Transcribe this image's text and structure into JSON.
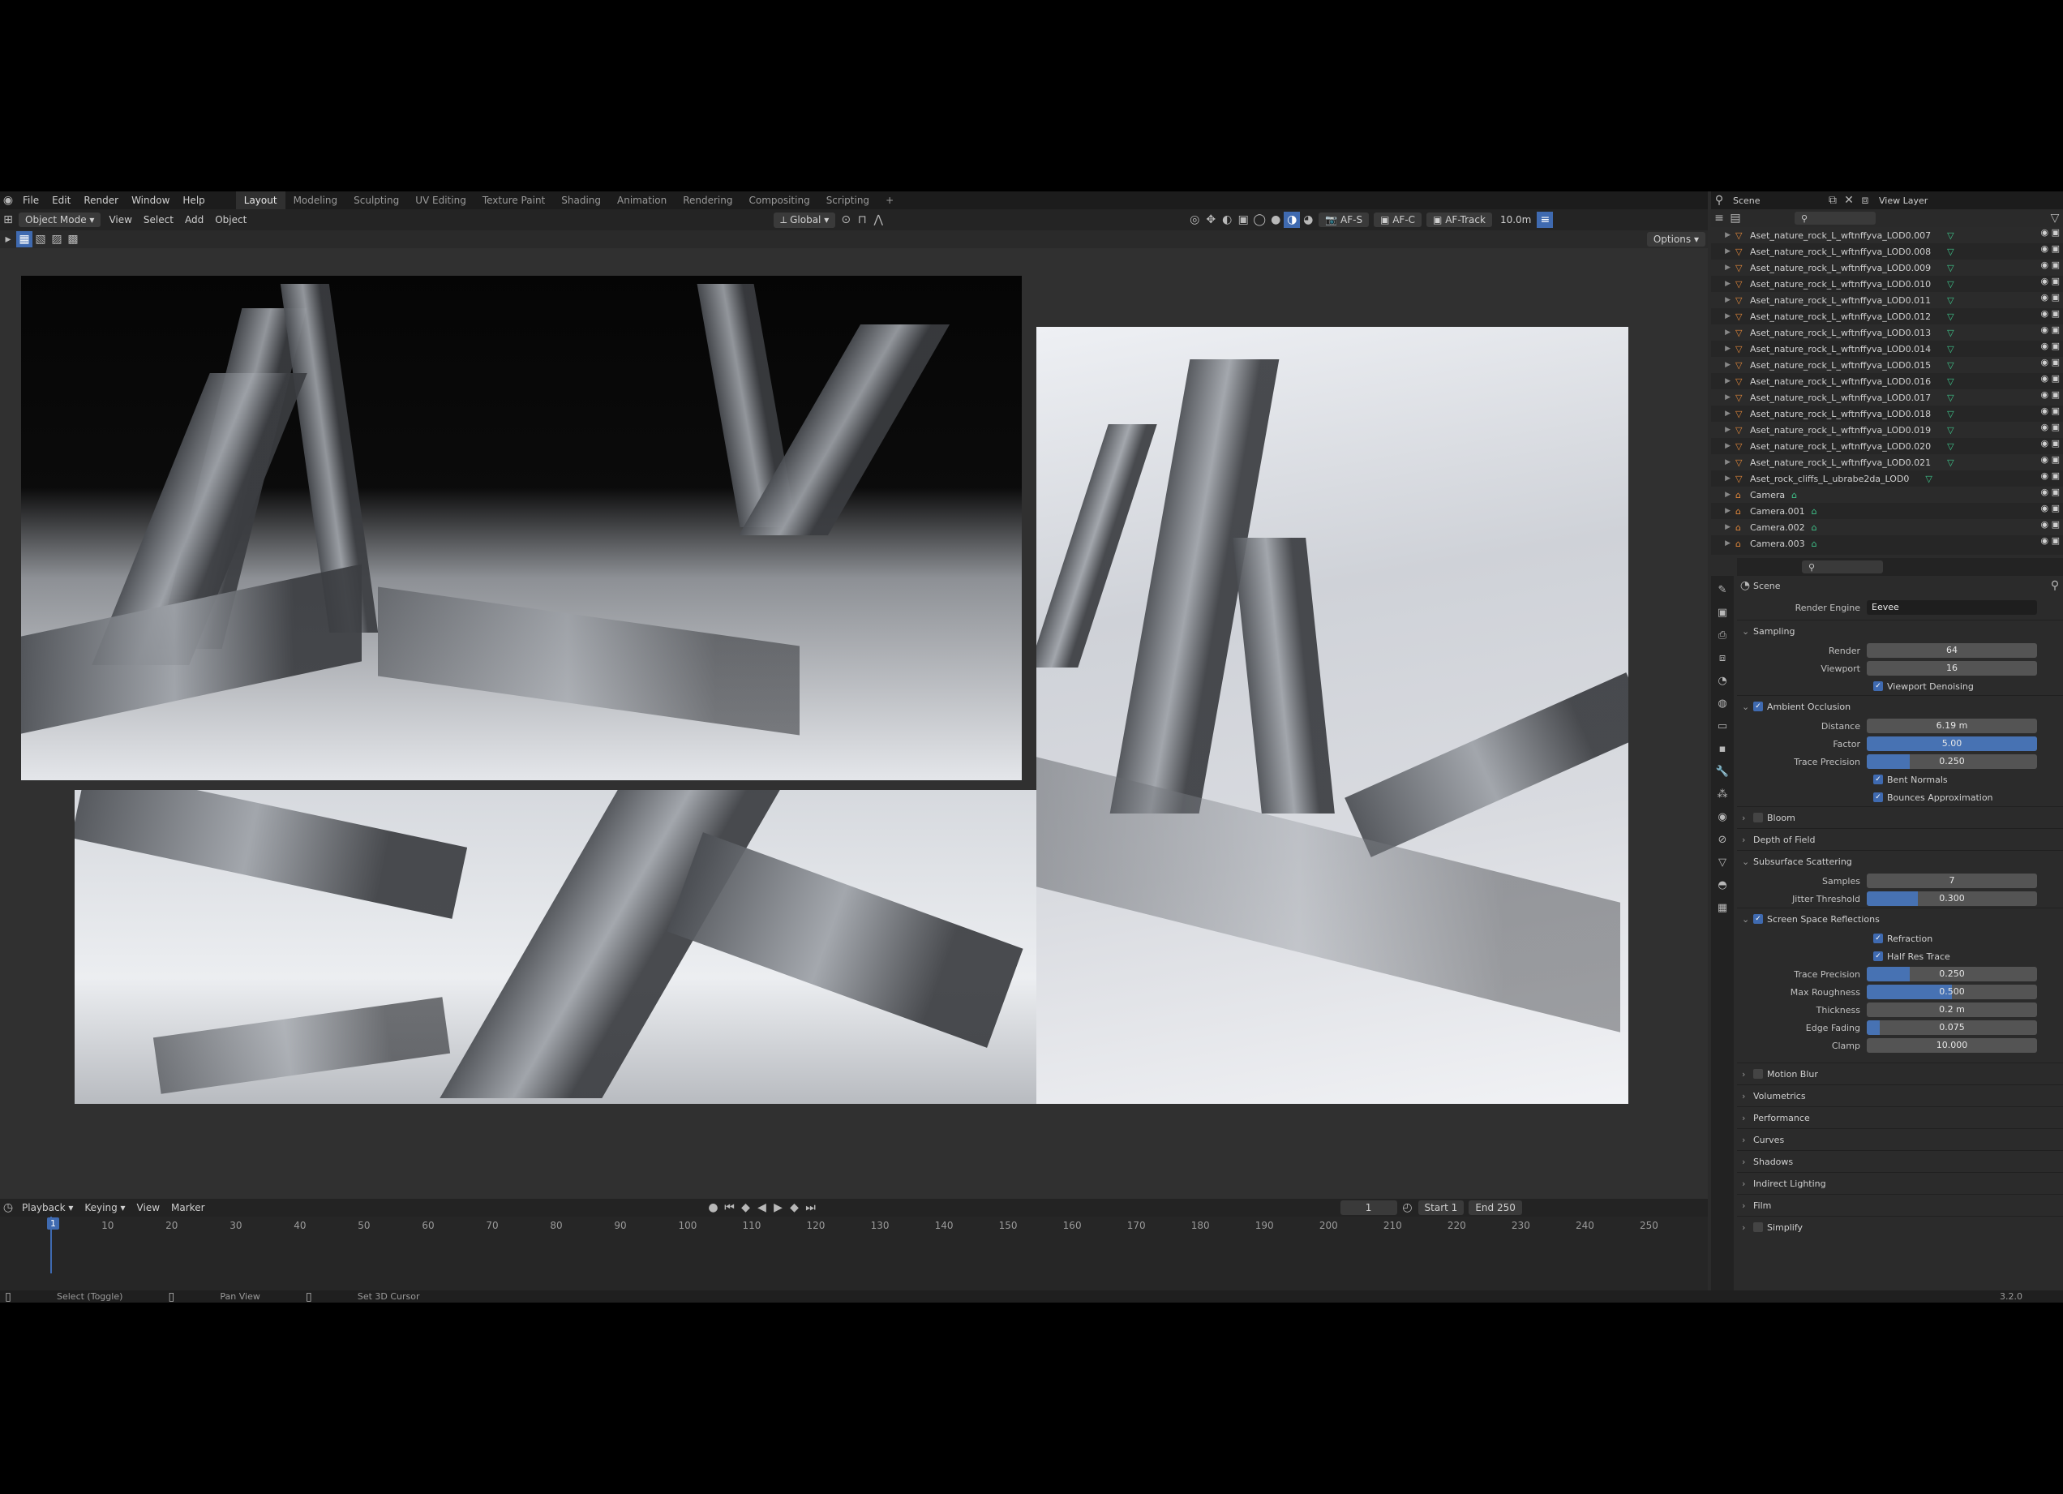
{
  "topbar": {
    "menus": [
      "File",
      "Edit",
      "Render",
      "Window",
      "Help"
    ],
    "workspaces": [
      "Layout",
      "Modeling",
      "Sculpting",
      "UV Editing",
      "Texture Paint",
      "Shading",
      "Animation",
      "Rendering",
      "Compositing",
      "Scripting"
    ],
    "active_workspace": "Layout",
    "add_label": "+"
  },
  "header": {
    "mode": "Object Mode",
    "menus": [
      "View",
      "Select",
      "Add",
      "Object"
    ],
    "orientation": "Global",
    "af_s": "AF-S",
    "af_c": "AF-C",
    "af_track": "AF-Track",
    "distance": "10.0m",
    "options": "Options"
  },
  "timeline": {
    "menus": [
      "Playback",
      "Keying",
      "View",
      "Marker"
    ],
    "current_frame": "1",
    "start_label": "Start",
    "start": "1",
    "end_label": "End",
    "end": "250",
    "ticks": [
      "1",
      "10",
      "20",
      "30",
      "40",
      "50",
      "60",
      "70",
      "80",
      "90",
      "100",
      "110",
      "120",
      "130",
      "140",
      "150",
      "160",
      "170",
      "180",
      "190",
      "200",
      "210",
      "220",
      "230",
      "240",
      "250"
    ]
  },
  "status": {
    "select": "Select (Toggle)",
    "pan": "Pan View",
    "cursor": "Set 3D Cursor",
    "version": "3.2.0"
  },
  "outliner": {
    "scene": "Scene",
    "view_layer": "View Layer",
    "items": [
      {
        "name": "Aset_nature_rock_L_wftnffyva_LOD0.007",
        "icon": "mesh-icon"
      },
      {
        "name": "Aset_nature_rock_L_wftnffyva_LOD0.008",
        "icon": "mesh-icon"
      },
      {
        "name": "Aset_nature_rock_L_wftnffyva_LOD0.009",
        "icon": "mesh-icon"
      },
      {
        "name": "Aset_nature_rock_L_wftnffyva_LOD0.010",
        "icon": "mesh-icon"
      },
      {
        "name": "Aset_nature_rock_L_wftnffyva_LOD0.011",
        "icon": "mesh-icon"
      },
      {
        "name": "Aset_nature_rock_L_wftnffyva_LOD0.012",
        "icon": "mesh-icon"
      },
      {
        "name": "Aset_nature_rock_L_wftnffyva_LOD0.013",
        "icon": "mesh-icon"
      },
      {
        "name": "Aset_nature_rock_L_wftnffyva_LOD0.014",
        "icon": "mesh-icon"
      },
      {
        "name": "Aset_nature_rock_L_wftnffyva_LOD0.015",
        "icon": "mesh-icon"
      },
      {
        "name": "Aset_nature_rock_L_wftnffyva_LOD0.016",
        "icon": "mesh-icon"
      },
      {
        "name": "Aset_nature_rock_L_wftnffyva_LOD0.017",
        "icon": "mesh-icon"
      },
      {
        "name": "Aset_nature_rock_L_wftnffyva_LOD0.018",
        "icon": "mesh-icon"
      },
      {
        "name": "Aset_nature_rock_L_wftnffyva_LOD0.019",
        "icon": "mesh-icon"
      },
      {
        "name": "Aset_nature_rock_L_wftnffyva_LOD0.020",
        "icon": "mesh-icon"
      },
      {
        "name": "Aset_nature_rock_L_wftnffyva_LOD0.021",
        "icon": "mesh-icon"
      },
      {
        "name": "Aset_rock_cliffs_L_ubrabe2da_LOD0",
        "icon": "mesh-icon"
      },
      {
        "name": "Camera",
        "icon": "camera-icon"
      },
      {
        "name": "Camera.001",
        "icon": "camera-icon"
      },
      {
        "name": "Camera.002",
        "icon": "camera-icon"
      },
      {
        "name": "Camera.003",
        "icon": "camera-icon"
      }
    ]
  },
  "properties": {
    "context": "Scene",
    "render_engine_label": "Render Engine",
    "render_engine": "Eevee",
    "sampling": {
      "title": "Sampling",
      "render_label": "Render",
      "render": "64",
      "viewport_label": "Viewport",
      "viewport": "16",
      "denoise": "Viewport Denoising"
    },
    "ao": {
      "title": "Ambient Occlusion",
      "distance_label": "Distance",
      "distance": "6.19 m",
      "factor_label": "Factor",
      "factor": "5.00",
      "factor_fill": 1.0,
      "trace_label": "Trace Precision",
      "trace": "0.250",
      "trace_fill": 0.25,
      "bent": "Bent Normals",
      "bounces": "Bounces Approximation"
    },
    "bloom": "Bloom",
    "dof": "Depth of Field",
    "sss": {
      "title": "Subsurface Scattering",
      "samples_label": "Samples",
      "samples": "7",
      "jitter_label": "Jitter Threshold",
      "jitter": "0.300",
      "jitter_fill": 0.3
    },
    "ssr": {
      "title": "Screen Space Reflections",
      "refraction": "Refraction",
      "half_res": "Half Res Trace",
      "trace_label": "Trace Precision",
      "trace": "0.250",
      "trace_fill": 0.25,
      "roughness_label": "Max Roughness",
      "roughness": "0.500",
      "roughness_fill": 0.5,
      "thickness_label": "Thickness",
      "thickness": "0.2 m",
      "edge_label": "Edge Fading",
      "edge": "0.075",
      "edge_fill": 0.075,
      "clamp_label": "Clamp",
      "clamp": "10.000"
    },
    "collapsed": [
      "Motion Blur",
      "Volumetrics",
      "Performance",
      "Curves",
      "Shadows",
      "Indirect Lighting",
      "Film",
      "Simplify"
    ]
  },
  "colors": {
    "accent": "#4772b3",
    "mesh": "#e1873a",
    "vis": "#3ec48a"
  }
}
